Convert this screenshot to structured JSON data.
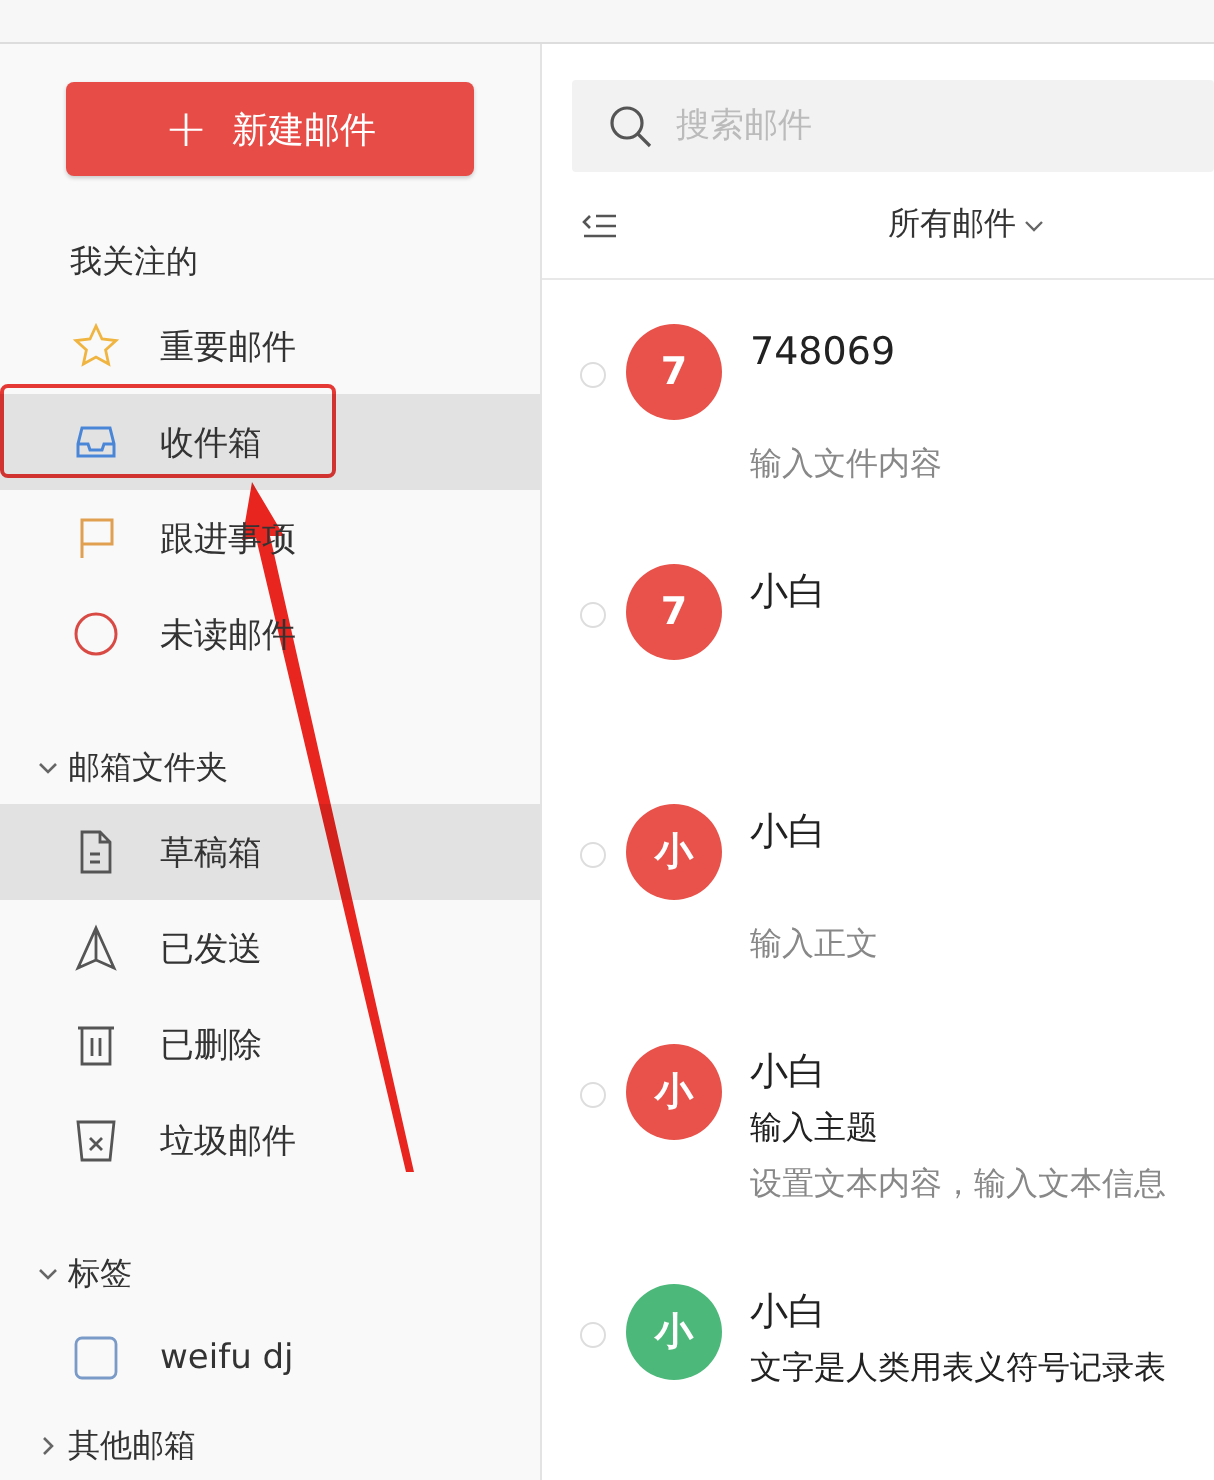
{
  "sidebar": {
    "compose_button": {
      "icon": "+",
      "label": "新建邮件"
    },
    "sections": [
      {
        "title": "我关注的",
        "items": [
          {
            "kind": "star",
            "label": "重要邮件",
            "selected": false
          },
          {
            "kind": "inbox",
            "label": "收件箱",
            "selected": true
          },
          {
            "kind": "flag",
            "label": "跟进事项",
            "selected": false
          },
          {
            "kind": "unread",
            "label": "未读邮件",
            "selected": false
          }
        ]
      },
      {
        "title": "邮箱文件夹",
        "expanded": true,
        "items": [
          {
            "kind": "draft",
            "label": "草稿箱",
            "selected": true
          },
          {
            "kind": "sent",
            "label": "已发送",
            "selected": false
          },
          {
            "kind": "trash",
            "label": "已删除",
            "selected": false
          },
          {
            "kind": "spam",
            "label": "垃圾邮件",
            "selected": false
          }
        ]
      },
      {
        "title": "标签",
        "expanded": true,
        "items": [
          {
            "kind": "tag",
            "label": "weifu dj",
            "selected": false
          }
        ]
      },
      {
        "title": "其他邮箱",
        "expanded": false
      }
    ]
  },
  "mail_list": {
    "search": {
      "placeholder": "搜索邮件"
    },
    "filter": "所有邮件",
    "mails": [
      {
        "selected": false,
        "avatar": "7",
        "color": "#e8524a",
        "sender": "748069",
        "preview": "输入文件内容"
      },
      {
        "selected": false,
        "avatar": "7",
        "color": "#e8524a",
        "sender": "小白"
      },
      {
        "selected": false,
        "avatar": "小",
        "color": "#e8524a",
        "sender": "小白",
        "preview": "输入正文"
      },
      {
        "selected": false,
        "avatar": "小",
        "color": "#e8524a",
        "sender": "小白",
        "subject": "输入主题",
        "preview": "设置文本内容，输入文本信息"
      },
      {
        "selected": false,
        "avatar": "小",
        "color": "#4cb87a",
        "sender": "小白",
        "subject": "文字是人类用表义符号记录表"
      }
    ]
  },
  "annotation": {
    "highlight": true,
    "arrow": true
  }
}
